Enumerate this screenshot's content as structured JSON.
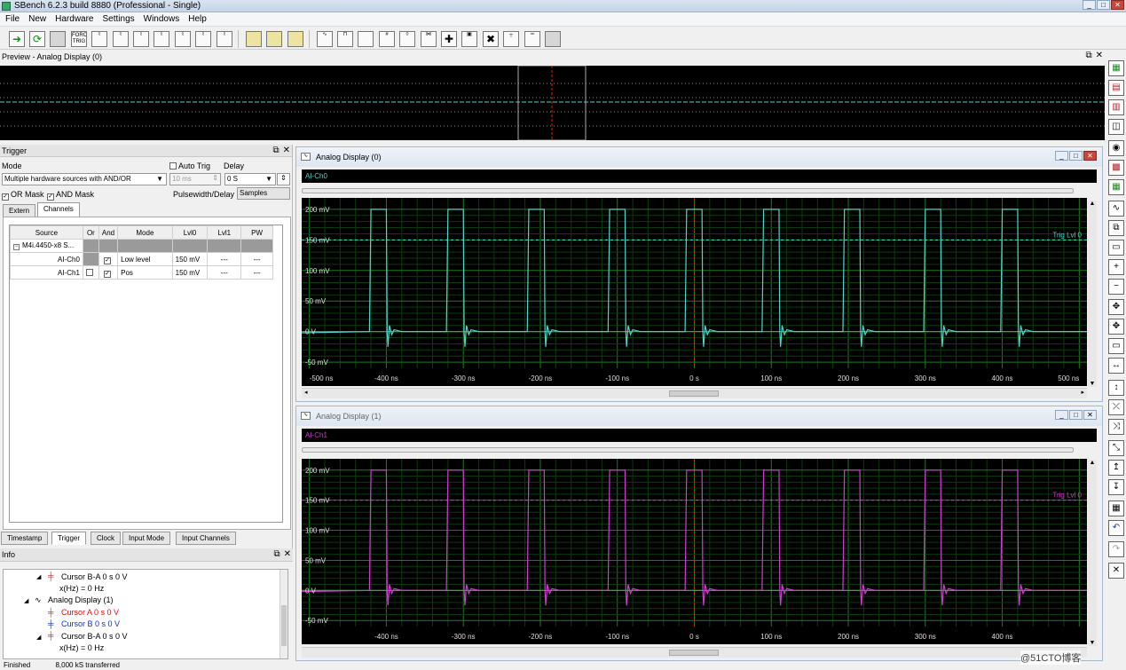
{
  "app": {
    "title": "SBench 6.2.3 build 8880 (Professional - Single)"
  },
  "menu": [
    "File",
    "New",
    "Hardware",
    "Settings",
    "Windows",
    "Help"
  ],
  "toolbar": {
    "force_trig": "FORCE TRIG"
  },
  "preview": {
    "title": "Preview - Analog Display (0)"
  },
  "trigger": {
    "title": "Trigger",
    "mode_label": "Mode",
    "mode_value": "Multiple hardware sources with AND/OR",
    "auto_trig": "Auto Trig",
    "auto_trig_value": "10 ms",
    "delay_label": "Delay",
    "delay_value": "0 S",
    "or_mask": "OR Mask",
    "and_mask": "AND Mask",
    "pulse_label": "Pulsewidth/Delay in",
    "pulse_unit": "Samples",
    "tabs": [
      "Extern",
      "Channels"
    ],
    "columns": [
      "Source",
      "Or",
      "And",
      "Mode",
      "Lvl0",
      "Lvl1",
      "PW"
    ],
    "group": "M4i.4450-x8 S...",
    "rows": [
      {
        "source": "AI-Ch0",
        "or": false,
        "and": true,
        "mode": "Low level",
        "lvl0": "150 mV",
        "lvl1": "---",
        "pw": "---"
      },
      {
        "source": "AI-Ch1",
        "or": false,
        "and": true,
        "mode": "Pos",
        "lvl0": "150 mV",
        "lvl1": "---",
        "pw": "---"
      }
    ],
    "bottom_tabs": [
      "Timestamp",
      "Trigger",
      "Clock",
      "Input Mode",
      "Input Channels"
    ]
  },
  "info": {
    "title": "Info",
    "lines": [
      {
        "text": "Cursor B-A  0 s  0 V",
        "color": "#000000"
      },
      {
        "text": "x(Hz) = 0 Hz",
        "color": "#000000"
      },
      {
        "text": "Analog Display (1)",
        "color": "#000000"
      },
      {
        "text": "Cursor A  0 s  0 V",
        "color": "#d01010"
      },
      {
        "text": "Cursor B  0 s  0 V",
        "color": "#1030c0"
      },
      {
        "text": "Cursor B-A  0 s  0 V",
        "color": "#000000"
      },
      {
        "text": "x(Hz) = 0 Hz",
        "color": "#000000"
      }
    ]
  },
  "status": {
    "text": "Finished",
    "transferred": "8,000 kS transferred"
  },
  "watermark": "@51CTO博客",
  "displays": [
    {
      "title": "Analog Display (0)",
      "channel": "AI-Ch0",
      "color": "#4fd6c8",
      "trig_label": "Trig Lvl 0",
      "y_ticks": [
        "200 mV",
        "150 mV",
        "100 mV",
        "50 mV",
        "0 V",
        "-50 mV"
      ],
      "x_ticks": [
        "-500 ns",
        "-400 ns",
        "-300 ns",
        "-200 ns",
        "-100 ns",
        "0 s",
        "100 ns",
        "200 ns",
        "300 ns",
        "400 ns",
        "500 ns"
      ]
    },
    {
      "title": "Analog Display (1)",
      "channel": "AI-Ch1",
      "color": "#d23ad2",
      "trig_label": "Trig Lvl 0",
      "y_ticks": [
        "200 mV",
        "150 mV",
        "100 mV",
        "50 mV",
        "0 V",
        "-50 mV"
      ],
      "x_ticks": [
        "-400 ns",
        "-300 ns",
        "-200 ns",
        "-100 ns",
        "0 s",
        "100 ns",
        "200 ns",
        "300 ns",
        "400 ns"
      ]
    }
  ],
  "chart_data": [
    {
      "type": "line",
      "series": [
        {
          "name": "AI-Ch0",
          "x": [
            -500,
            -420,
            -400,
            -320,
            -300,
            -210,
            -190,
            -110,
            -90,
            -10,
            0,
            10,
            90,
            110,
            190,
            210,
            290,
            310,
            390,
            410,
            500
          ],
          "pulse_centers": [
            -410,
            -310,
            -205,
            -100,
            0,
            100,
            205,
            310,
            410
          ],
          "high": 200,
          "low": 0,
          "trigger_level": 150
        }
      ],
      "xlabel": "",
      "ylabel": "",
      "xlim": [
        -510,
        510
      ],
      "ylim": [
        -60,
        210
      ],
      "grid": true
    },
    {
      "type": "line",
      "series": [
        {
          "name": "AI-Ch1",
          "pulse_centers": [
            -410,
            -310,
            -205,
            -100,
            0,
            100,
            205,
            310,
            410
          ],
          "high": 200,
          "low": 0,
          "trigger_level": 150
        }
      ],
      "xlabel": "",
      "ylabel": "",
      "xlim": [
        -510,
        510
      ],
      "ylim": [
        -60,
        210
      ],
      "grid": true
    }
  ]
}
